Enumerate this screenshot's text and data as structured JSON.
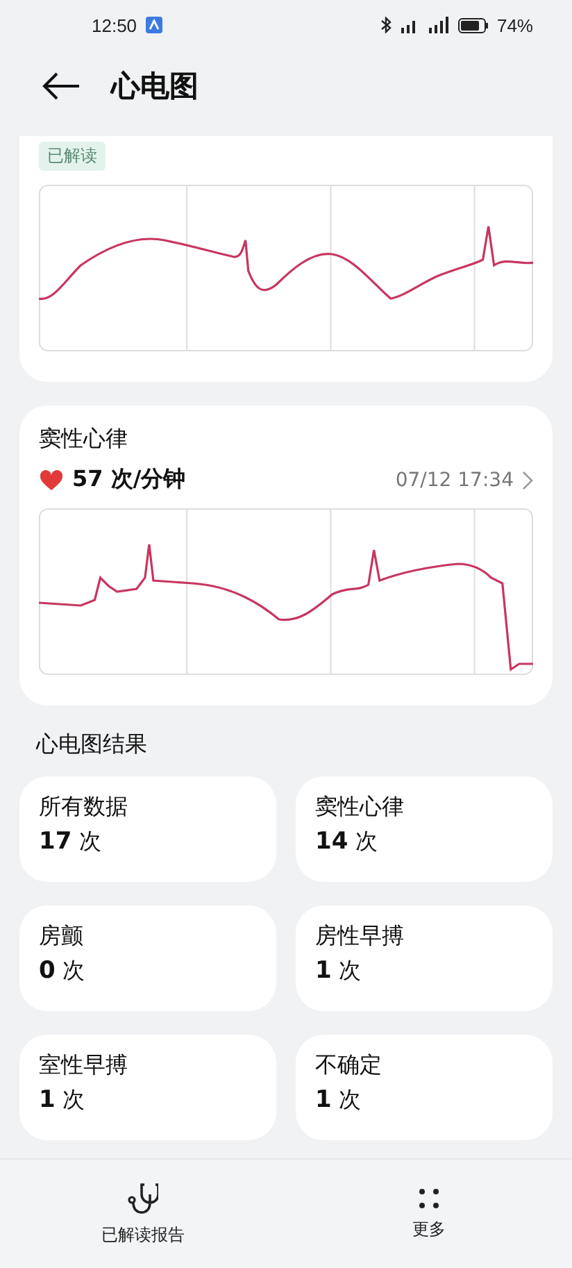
{
  "status_bar": {
    "time": "12:50",
    "battery": "74%"
  },
  "header": {
    "title": "心电图"
  },
  "records": [
    {
      "badge": "已解读"
    },
    {
      "title": "窦性心律",
      "heart_rate": "57 次/分钟",
      "timestamp": "07/12 17:34"
    }
  ],
  "results": {
    "title": "心电图结果",
    "tiles": [
      {
        "label": "所有数据",
        "count": "17",
        "unit": "次"
      },
      {
        "label": "窦性心律",
        "count": "14",
        "unit": "次"
      },
      {
        "label": "房颤",
        "count": "0",
        "unit": "次"
      },
      {
        "label": "房性早搏",
        "count": "1",
        "unit": "次"
      },
      {
        "label": "室性早搏",
        "count": "1",
        "unit": "次"
      },
      {
        "label": "不确定",
        "count": "1",
        "unit": "次"
      }
    ]
  },
  "bottom_nav": [
    {
      "label": "已解读报告"
    },
    {
      "label": "更多"
    }
  ]
}
